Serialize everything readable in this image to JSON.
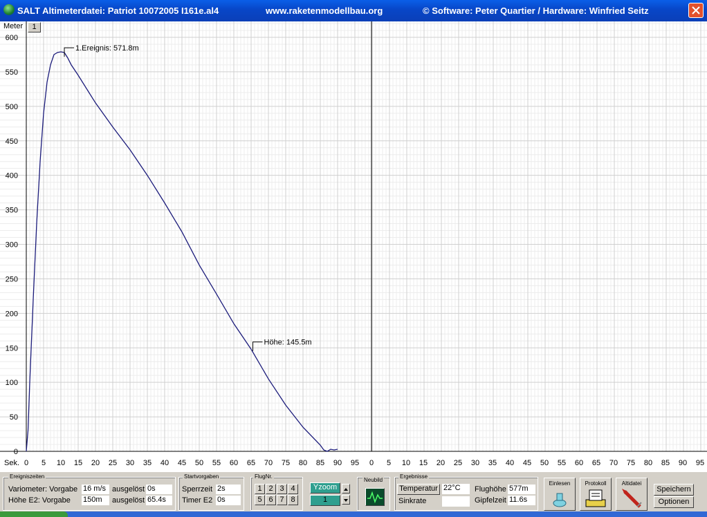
{
  "window": {
    "title_app": "SALT Altimeterdatei: Patriot 10072005 I161e.al4",
    "title_url": "www.raketenmodellbau.org",
    "title_credits": "©  Software: Peter Quartier / Hardware: Winfried Seitz"
  },
  "plot": {
    "y_unit": "Meter",
    "x_unit": "Sek.",
    "page_button": "1",
    "annotation_event": "1.Ereignis: 571.8m",
    "annotation_height": "Höhe: 145.5m"
  },
  "chart_data": {
    "type": "line",
    "xlabel": "Sek.",
    "ylabel": "Meter",
    "ylim": [
      0,
      600
    ],
    "y_ticks": [
      0,
      50,
      100,
      150,
      200,
      250,
      300,
      350,
      400,
      450,
      500,
      550,
      600
    ],
    "x_ticks_left": [
      0,
      5,
      10,
      15,
      20,
      25,
      30,
      35,
      40,
      45,
      50,
      55,
      60,
      65,
      70,
      75,
      80,
      85,
      90,
      95
    ],
    "x_ticks_right": [
      0,
      5,
      10,
      15,
      20,
      25,
      30,
      35,
      40,
      45,
      50,
      55,
      60,
      65,
      70,
      75,
      80,
      85,
      90,
      95
    ],
    "grid": true,
    "series": [
      {
        "values_x": [
          0,
          0.5,
          1,
          2,
          3,
          4,
          5,
          6,
          7,
          8,
          9,
          10,
          11,
          12,
          13,
          15,
          20,
          25,
          30,
          35,
          40,
          45,
          50,
          55,
          60,
          65,
          70,
          75,
          80,
          85,
          86,
          87,
          88,
          89,
          90
        ],
        "values_y": [
          0,
          30,
          100,
          220,
          330,
          420,
          490,
          535,
          560,
          575,
          578,
          579,
          578,
          570,
          560,
          545,
          505,
          470,
          437,
          400,
          360,
          318,
          270,
          228,
          185,
          148,
          105,
          67,
          35,
          9,
          2,
          0,
          3,
          2,
          3
        ]
      }
    ],
    "annotations": [
      {
        "x": 11,
        "y": 571.8,
        "text": "1.Ereignis: 571.8m"
      },
      {
        "x": 65.5,
        "y": 145.5,
        "text": "Höhe: 145.5m"
      }
    ]
  },
  "panel": {
    "ereignis": {
      "title": "Ereigniszeiten",
      "row1_label": "Variometer: Vorgabe",
      "row1_value": "16 m/s",
      "row1_trig_label": "ausgelöst",
      "row1_trig_value": "0s",
      "row2_label": "Höhe E2:   Vorgabe",
      "row2_value": "150m",
      "row2_trig_label": "ausgelöst",
      "row2_trig_value": "65.4s"
    },
    "start": {
      "title": "Startvorgaben",
      "sperrzeit_label": "Sperrzeit",
      "sperrzeit_value": "2s",
      "timer_label": "Timer E2",
      "timer_value": "0s"
    },
    "flug": {
      "title": "FlugNr.",
      "buttons": [
        "1",
        "2",
        "3",
        "4",
        "5",
        "6",
        "7",
        "8"
      ]
    },
    "yzoom": {
      "label": "Yzoom",
      "value": "1"
    },
    "neubild": {
      "title": "Neubild"
    },
    "ergebnisse": {
      "title": "Ergebnisse",
      "temp_button": "Temperatur",
      "temp_value": "22°C",
      "sink_label": "Sinkrate",
      "sink_value": "",
      "flughoehe_label": "Flughöhe",
      "flughoehe_value": "577m",
      "gipfel_label": "Gipfelzeit",
      "gipfel_value": "11.6s"
    },
    "einlesen": "Einlesen",
    "protokoll": "Protokoll",
    "altidatei": "Altidatei",
    "speichern": "Speichern",
    "optionen": "Optionen"
  }
}
